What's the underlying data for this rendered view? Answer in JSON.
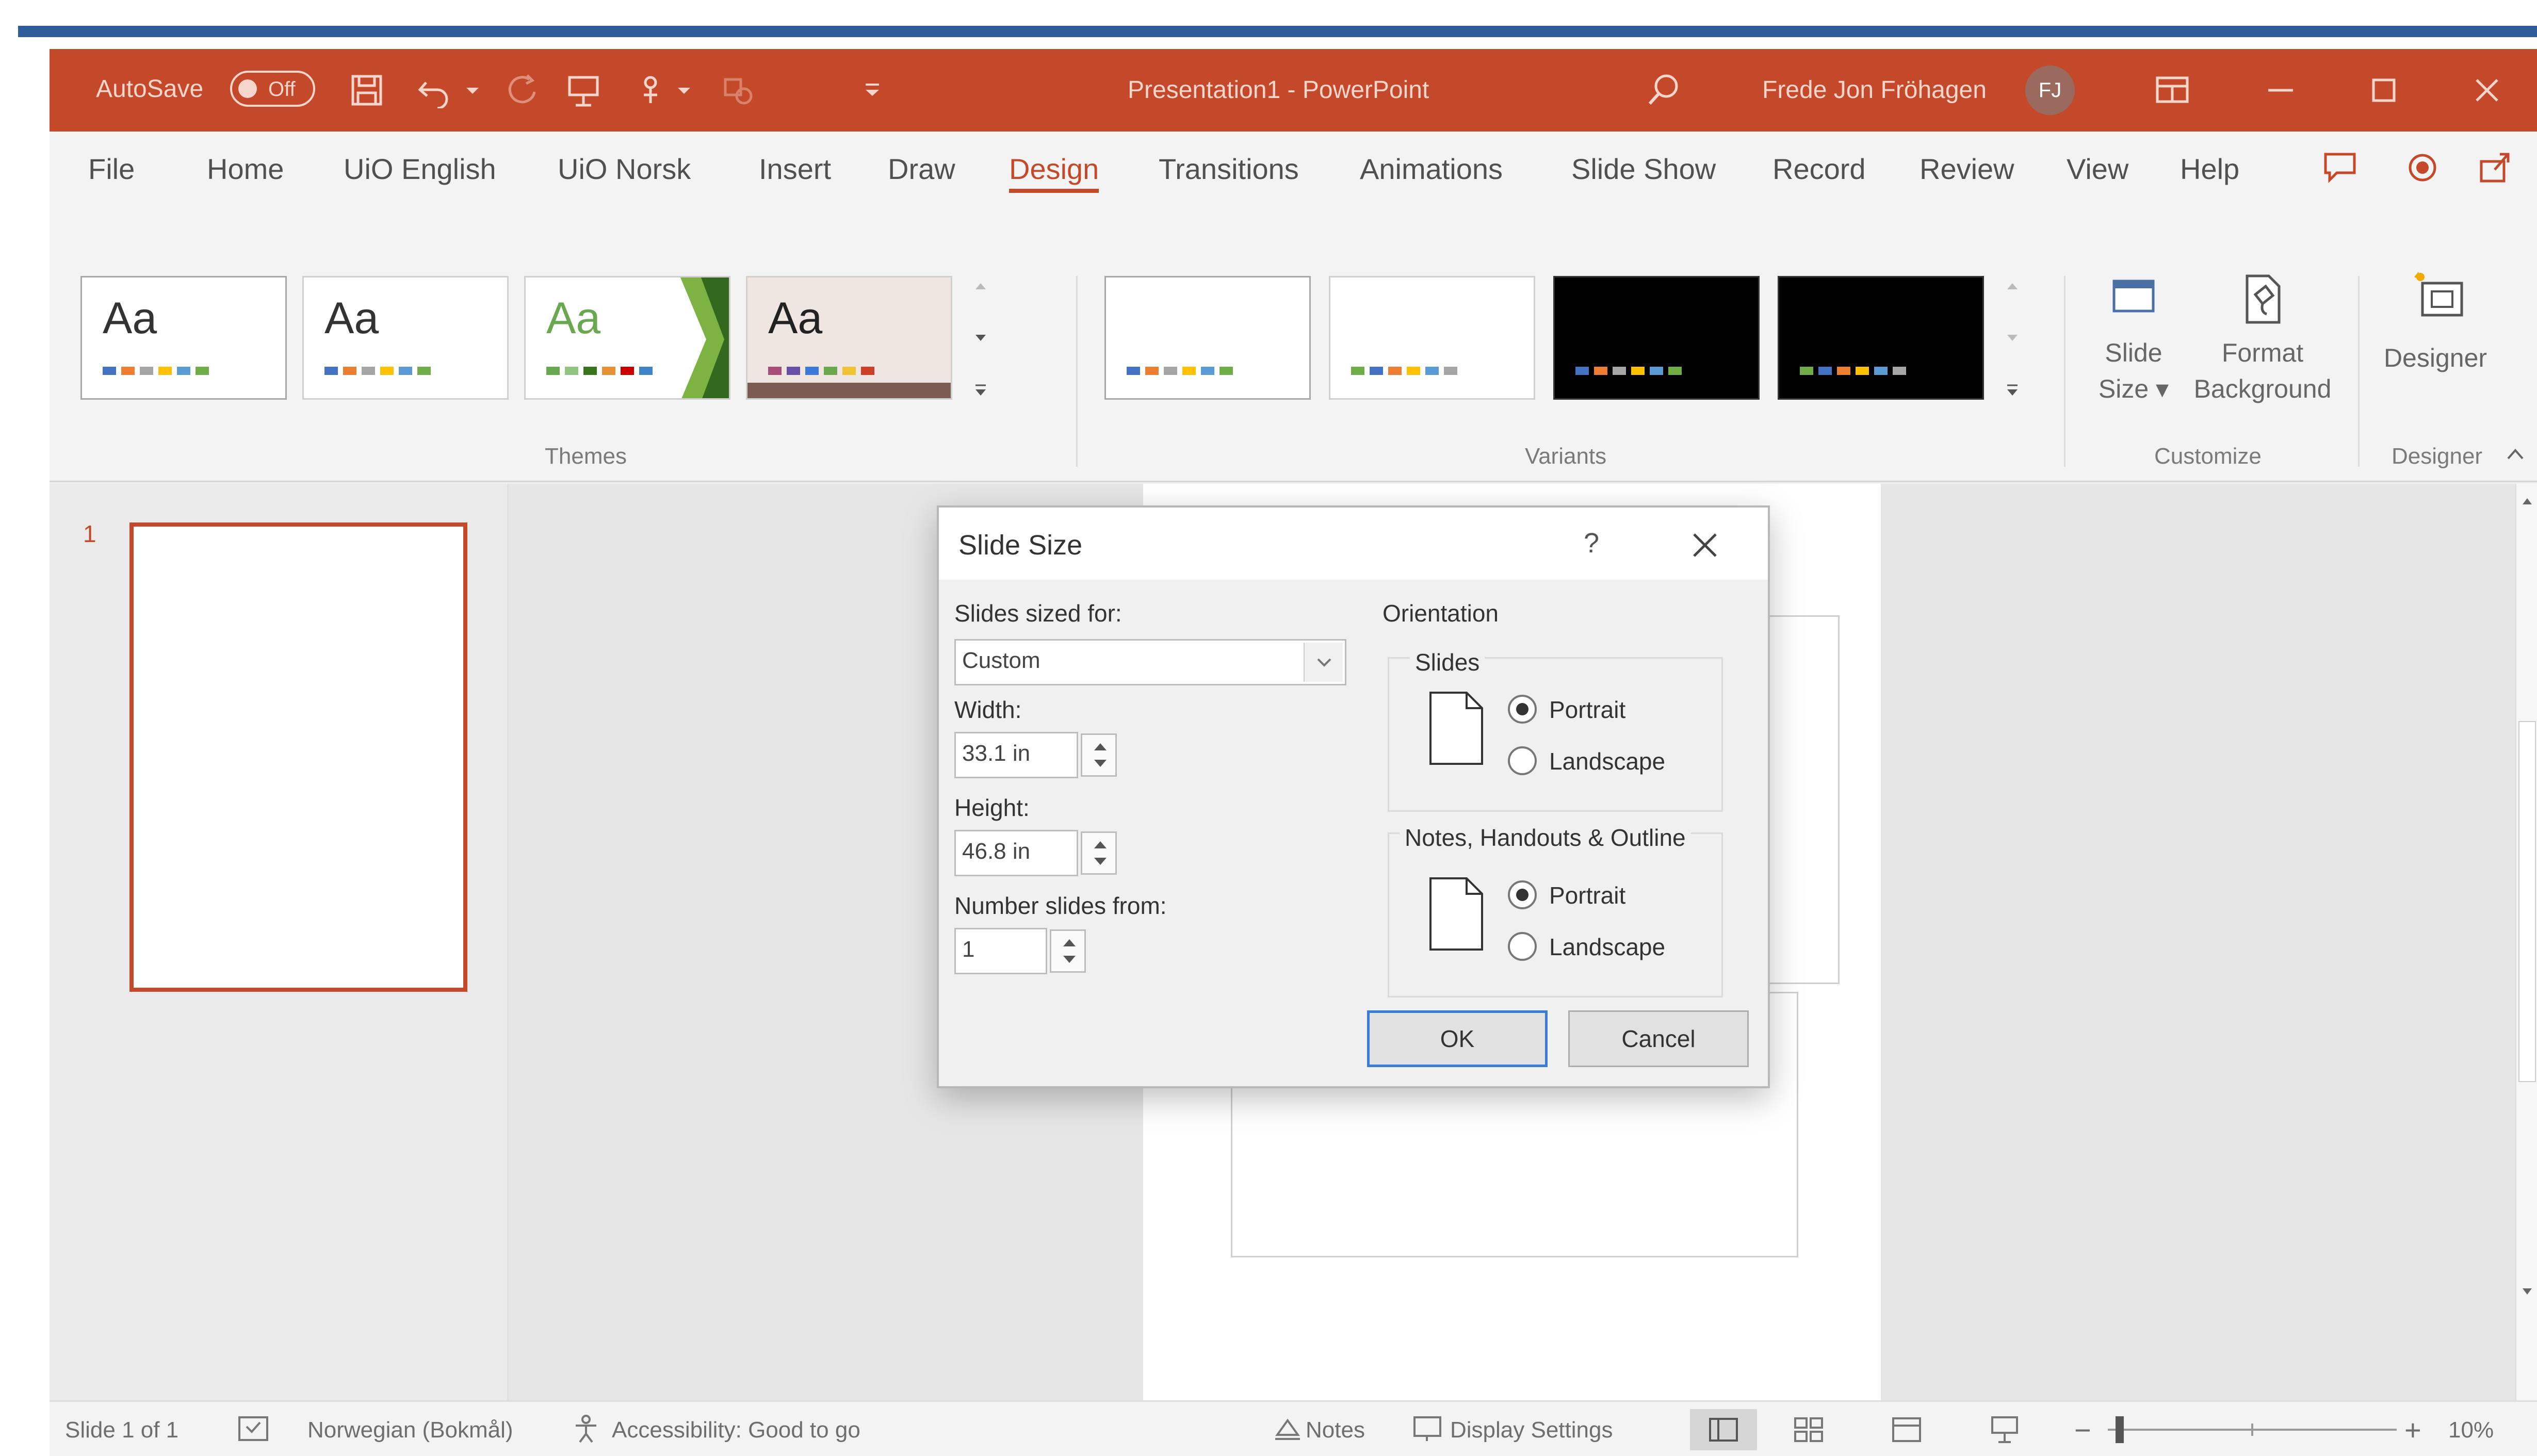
{
  "titlebar": {
    "autosave_label": "AutoSave",
    "autosave_state": "Off",
    "doc_title": "Presentation1 - PowerPoint",
    "user_name": "Frede Jon Fröhagen",
    "user_initials": "FJ"
  },
  "tabs": [
    "File",
    "Home",
    "UiO English",
    "UiO Norsk",
    "Insert",
    "Draw",
    "Design",
    "Transitions",
    "Animations",
    "Slide Show",
    "Record",
    "Review",
    "View",
    "Help"
  ],
  "active_tab": "Design",
  "themes": {
    "label": "Themes",
    "items": [
      {
        "aa": "Aa",
        "colors": [
          "#4472c4",
          "#ed7d31",
          "#a5a5a5",
          "#ffc000",
          "#5b9bd5",
          "#70ad47"
        ]
      },
      {
        "aa": "Aa",
        "colors": [
          "#4472c4",
          "#ed7d31",
          "#a5a5a5",
          "#ffc000",
          "#5b9bd5",
          "#70ad47"
        ]
      },
      {
        "aa": "Aa",
        "colors": [
          "#6aa84f",
          "#93c47d",
          "#38761d",
          "#e69138",
          "#cc0000",
          "#3d85c6"
        ]
      },
      {
        "aa": "Aa",
        "colors": [
          "#a64d79",
          "#674ea7",
          "#3c78d8",
          "#6aa84f",
          "#f1c232",
          "#cc4125"
        ]
      }
    ]
  },
  "variants": {
    "label": "Variants",
    "items": [
      {
        "bg": "#ffffff",
        "colors": [
          "#4472c4",
          "#ed7d31",
          "#a5a5a5",
          "#ffc000",
          "#5b9bd5",
          "#70ad47"
        ]
      },
      {
        "bg": "#ffffff",
        "colors": [
          "#70ad47",
          "#4472c4",
          "#ed7d31",
          "#ffc000",
          "#5b9bd5",
          "#a5a5a5"
        ]
      },
      {
        "bg": "#000000",
        "colors": [
          "#4472c4",
          "#ed7d31",
          "#a5a5a5",
          "#ffc000",
          "#5b9bd5",
          "#70ad47"
        ]
      },
      {
        "bg": "#000000",
        "colors": [
          "#70ad47",
          "#4472c4",
          "#ed7d31",
          "#ffc000",
          "#5b9bd5",
          "#a5a5a5"
        ]
      }
    ]
  },
  "customize": {
    "label": "Customize",
    "slide_size_line1": "Slide",
    "slide_size_line2": "Size ▾",
    "format_bg_line1": "Format",
    "format_bg_line2": "Background"
  },
  "designer": {
    "button_label": "Designer",
    "group_label": "Designer"
  },
  "thumbnail": {
    "number": "1"
  },
  "dialog": {
    "title": "Slide Size",
    "help": "?",
    "slides_sized_for_label": "Slides sized for:",
    "slides_sized_for_value": "Custom",
    "width_label": "Width:",
    "width_value": "33.1 in",
    "height_label": "Height:",
    "height_value": "46.8 in",
    "number_from_label": "Number slides from:",
    "number_from_value": "1",
    "orientation_label": "Orientation",
    "slides_group_label": "Slides",
    "notes_group_label": "Notes, Handouts & Outline",
    "portrait": "Portrait",
    "landscape": "Landscape",
    "ok": "OK",
    "cancel": "Cancel"
  },
  "statusbar": {
    "slide_info": "Slide 1 of 1",
    "language": "Norwegian (Bokmål)",
    "accessibility": "Accessibility: Good to go",
    "notes": "Notes",
    "display_settings": "Display Settings",
    "zoom": "10%"
  },
  "colors": {
    "accent": "#c4492a",
    "title_bar": "#c4492a",
    "top_stripe": "#2e5d99"
  }
}
